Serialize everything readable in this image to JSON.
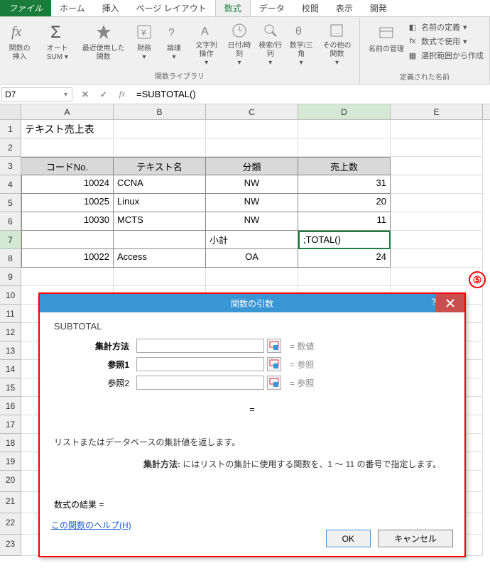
{
  "tabs": {
    "file": "ファイル",
    "home": "ホーム",
    "insert": "挿入",
    "pagelayout": "ページ レイアウト",
    "formulas": "数式",
    "data": "データ",
    "review": "校閲",
    "view": "表示",
    "developer": "開発"
  },
  "ribbon": {
    "insert_function": "関数の挿入",
    "autosum": "オートSUM",
    "recent": "最近使用した関数",
    "financial": "財務",
    "logical": "論理",
    "text": "文字列操作",
    "datetime": "日付/時刻",
    "lookup": "検索/行列",
    "math": "数学/三角",
    "more": "その他の関数",
    "library_group": "関数ライブラリ",
    "name_manager": "名前の管理",
    "define_name": "名前の定義",
    "use_in_formula": "数式で使用",
    "create_from_selection": "選択範囲から作成",
    "defined_names_group": "定義された名前"
  },
  "formula_bar": {
    "cell_ref": "D7",
    "formula": "=SUBTOTAL()"
  },
  "columns": [
    "A",
    "B",
    "C",
    "D",
    "E"
  ],
  "sheet": {
    "title": "テキスト売上表",
    "headers": {
      "code": "コードNo.",
      "name": "テキスト名",
      "category": "分類",
      "sales": "売上数"
    },
    "rows": [
      {
        "code": "10024",
        "name": "CCNA",
        "cat": "NW",
        "sales": "31"
      },
      {
        "code": "10025",
        "name": "Linux",
        "cat": "NW",
        "sales": "20"
      },
      {
        "code": "10030",
        "name": "MCTS",
        "cat": "NW",
        "sales": "11"
      }
    ],
    "subtotal_label": "小計",
    "d7_display": ";TOTAL()",
    "row8": {
      "code": "10022",
      "name": "Access",
      "cat": "OA",
      "sales": "24"
    }
  },
  "dialog": {
    "title": "関数の引数",
    "function": "SUBTOTAL",
    "args": [
      {
        "label": "集計方法",
        "hint": "数値",
        "bold": true
      },
      {
        "label": "参照1",
        "hint": "参照",
        "bold": true
      },
      {
        "label": "参照2",
        "hint": "参照",
        "bold": false
      }
    ],
    "eq": "=",
    "desc": "リストまたはデータベースの集計値を返します。",
    "desc2_label": "集計方法:",
    "desc2": "にはリストの集計に使用する関数を、1 ～ 11 の番号で指定します。",
    "result_label": "数式の結果 =",
    "help_link": "この関数のヘルプ(H)",
    "ok": "OK",
    "cancel": "キャンセル"
  },
  "callout": "⑤"
}
